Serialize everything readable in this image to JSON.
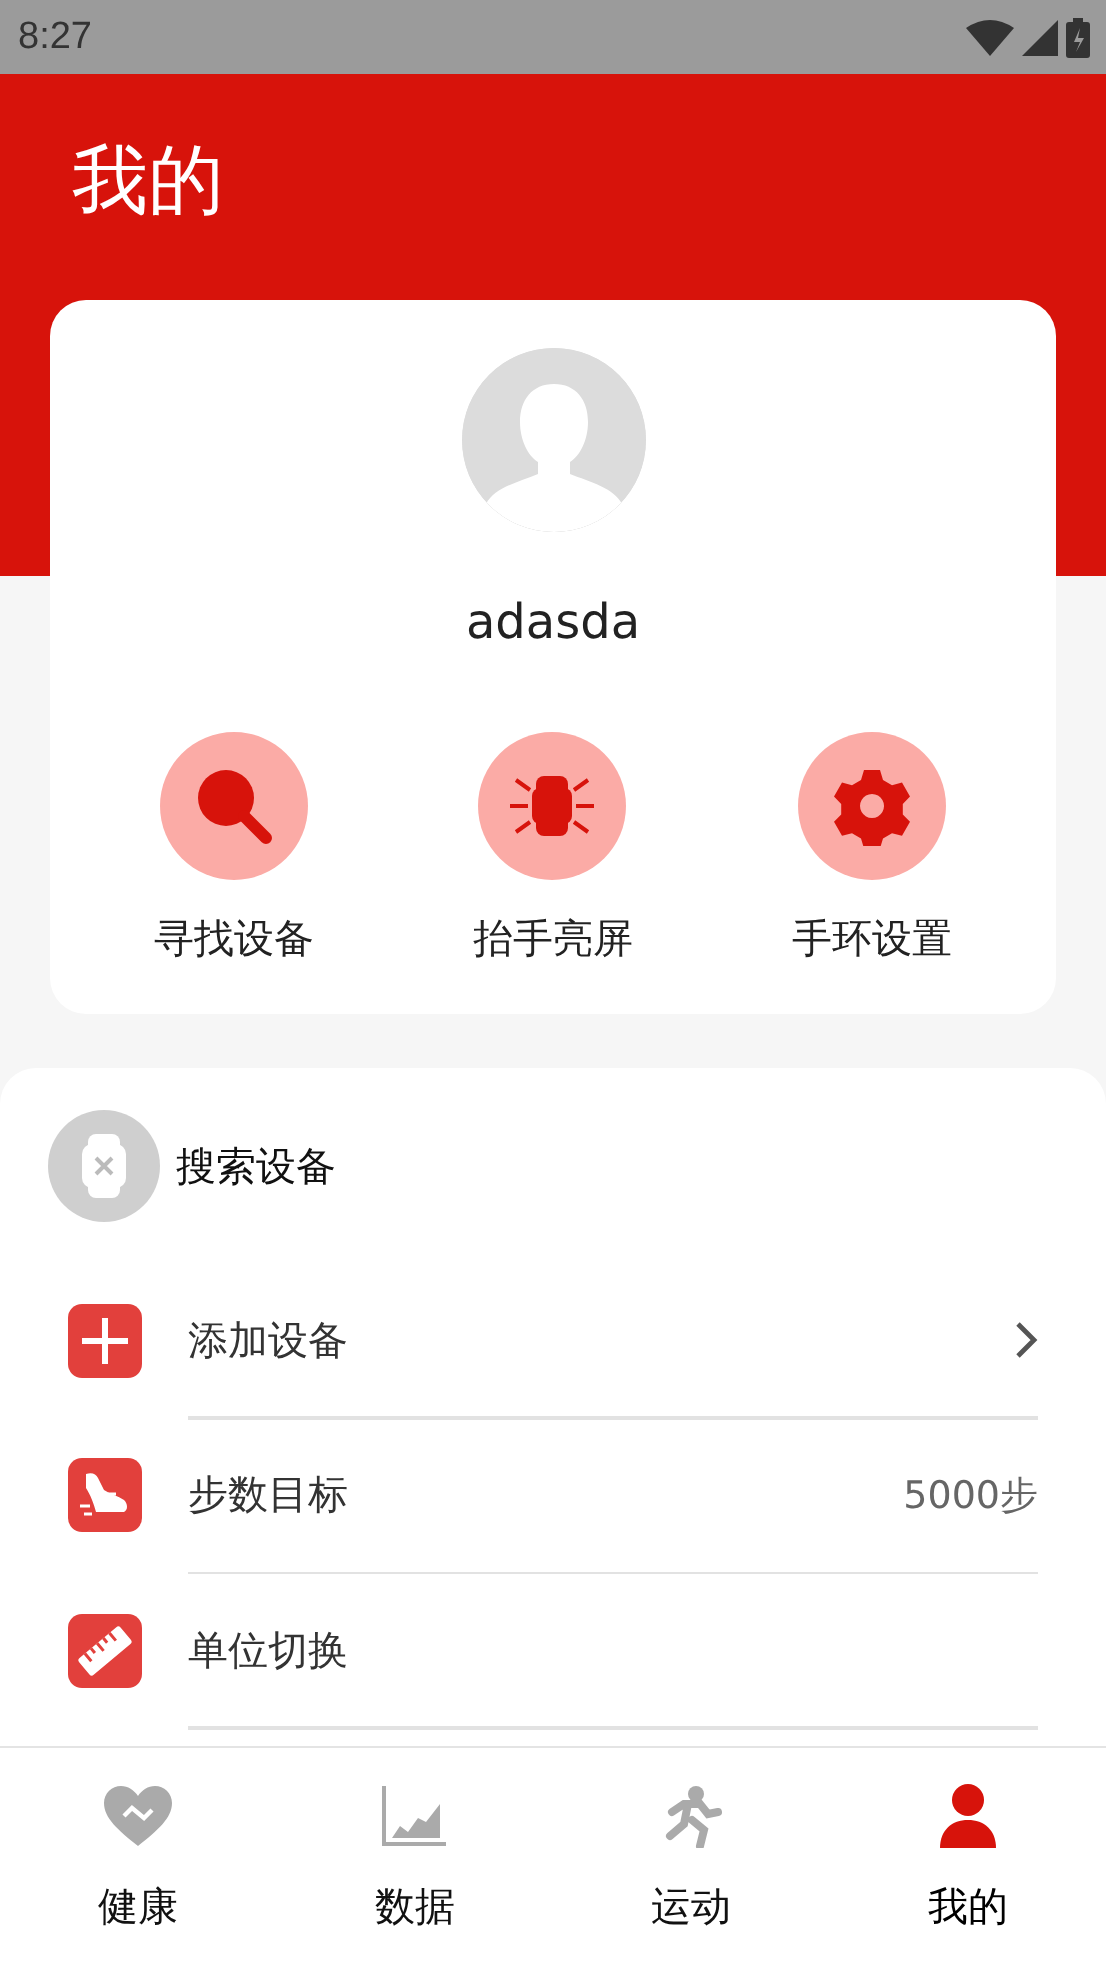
{
  "status_bar": {
    "time": "8:27"
  },
  "header": {
    "title": "我的"
  },
  "profile": {
    "name": "adasda"
  },
  "actions": [
    {
      "kind": "find",
      "label": "寻找设备"
    },
    {
      "kind": "raise",
      "label": "抬手亮屏"
    },
    {
      "kind": "settings",
      "label": "手环设置"
    }
  ],
  "device": {
    "label": "搜索设备"
  },
  "settings": [
    {
      "kind": "add",
      "label": "添加设备",
      "chevron": true
    },
    {
      "kind": "steps",
      "label": "步数目标",
      "value": "5000步",
      "chevron": false
    },
    {
      "kind": "unit",
      "label": "单位切换",
      "chevron": false
    }
  ],
  "tabs": [
    {
      "kind": "health",
      "label": "健康",
      "selected": false
    },
    {
      "kind": "data",
      "label": "数据",
      "selected": false
    },
    {
      "kind": "sport",
      "label": "运动",
      "selected": false
    },
    {
      "kind": "me",
      "label": "我的",
      "selected": true
    }
  ]
}
